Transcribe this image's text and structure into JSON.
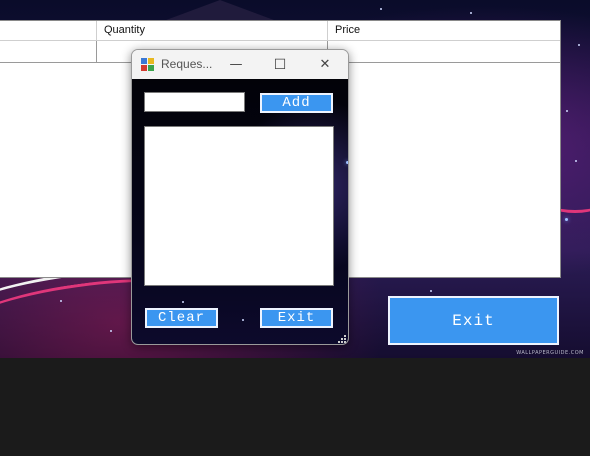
{
  "main_window": {
    "grid": {
      "columns": [
        "",
        "Quantity",
        "Price"
      ],
      "rows": [
        [
          "",
          "",
          ""
        ]
      ]
    },
    "exit_label": "Exit",
    "watermark": "WALLPAPERGUIDE.COM",
    "colors": {
      "button": "#3b96f0",
      "grid_bg": "#ffffff"
    }
  },
  "dialog": {
    "title": "Reques...",
    "icon": "app-form-icon",
    "titlebar_icons": [
      "minimize-icon",
      "maximize-icon",
      "close-icon"
    ],
    "minimize_glyph": "—",
    "maximize_glyph": "☐",
    "close_glyph": "✕",
    "input": {
      "value": "",
      "placeholder": ""
    },
    "add_label": "Add",
    "clear_label": "Clear",
    "exit_label": "Exit",
    "list_items": []
  }
}
